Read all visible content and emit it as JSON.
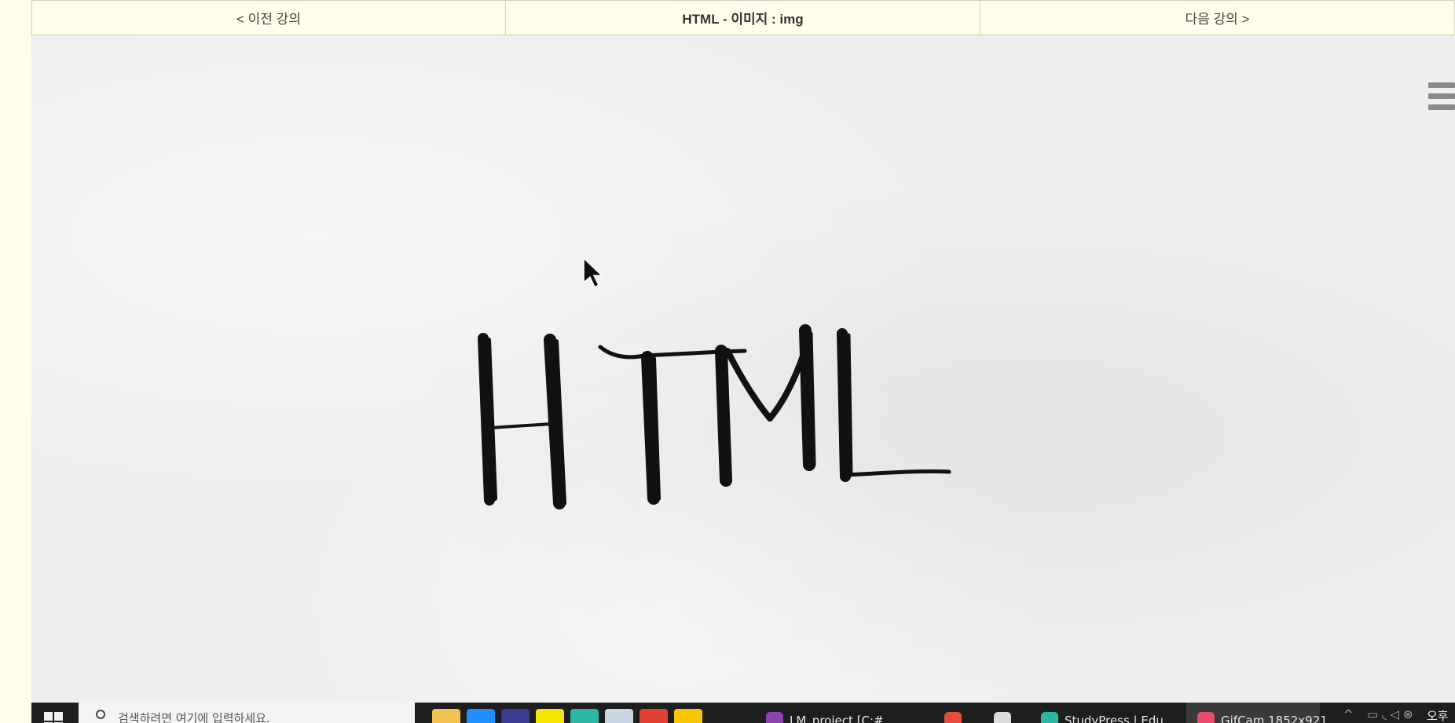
{
  "nav": {
    "prev_label": "< 이전 강의",
    "title": "HTML - 이미지 : img",
    "next_label": "다음 강의 >"
  },
  "stage": {
    "sketch_text": "HTML",
    "menu_icon": "hamburger-menu-icon"
  },
  "taskbar": {
    "search_placeholder": "검색하려면 여기에 입력하세요.",
    "pinned_apps": [
      {
        "name": "file-explorer-icon",
        "color": "#f2c14e"
      },
      {
        "name": "internet-explorer-icon",
        "color": "#1e90ff"
      },
      {
        "name": "eclipse-icon",
        "color": "#3b3b8f"
      },
      {
        "name": "kakaotalk-icon",
        "color": "#f7e600"
      },
      {
        "name": "edge-icon",
        "color": "#2bb7a3"
      },
      {
        "name": "database-icon",
        "color": "#c9d6e3"
      },
      {
        "name": "chrome-icon",
        "color": "#e34133"
      },
      {
        "name": "kakao-yellow-icon",
        "color": "#f7c600"
      }
    ],
    "windows": [
      {
        "label": "LM_project [C:#",
        "icon_color": "#8e44ad"
      },
      {
        "label": "",
        "icon_color": "#e74c3c"
      },
      {
        "label": "",
        "icon_color": "#dddddd"
      },
      {
        "label": "StudyPress | Edu",
        "icon_color": "#2bb7a3"
      },
      {
        "label": "GifCam 1852x921",
        "icon_color": "#e84c6a"
      }
    ],
    "clock_label": "오후"
  }
}
